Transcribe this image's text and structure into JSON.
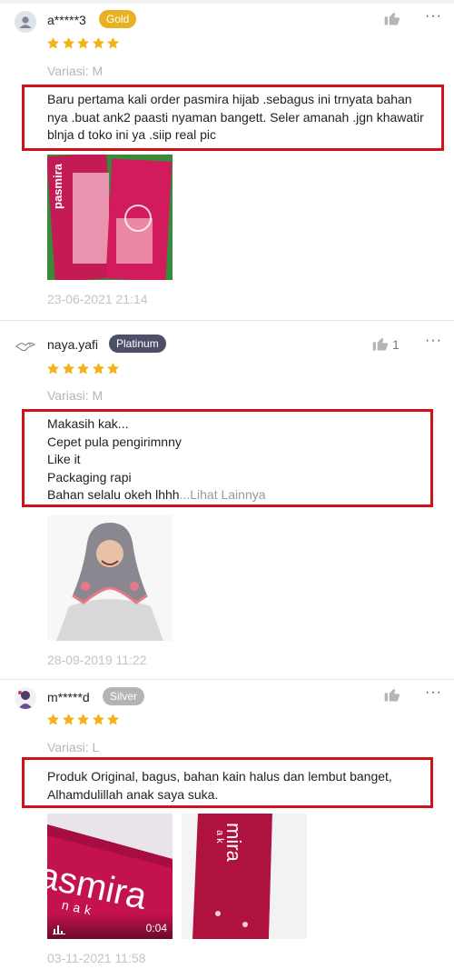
{
  "reviews": [
    {
      "username": "a*****3",
      "badge": "Gold",
      "badge_color": "#e7b122",
      "rating": 5,
      "variation": "Variasi: M",
      "comment_lines": [
        "Baru pertama kali order pasmira hijab .sebagus ini trnyata bahan",
        "nya .buat ank2 paasti nyaman bangett. Seler amanah .jgn khawatir",
        "blnja d toko ini ya .siip real pic"
      ],
      "like_count": "",
      "date": "23-06-2021 21:14",
      "photo_brand": "pasmira"
    },
    {
      "username": "naya.yafi",
      "badge": "Platinum",
      "badge_color": "#4d4f68",
      "rating": 5,
      "variation": "Variasi: M",
      "comment_lines": [
        "Makasih kak...",
        "Cepet pula pengirimnny",
        "Like it",
        "Packaging rapi",
        "Bahan selalu okeh lhhh"
      ],
      "see_more": "...Lihat Lainnya",
      "like_count": "1",
      "date": "28-09-2019 11:22"
    },
    {
      "username": "m*****d",
      "badge": "Silver",
      "badge_color": "#b4b4b4",
      "rating": 5,
      "variation": "Variasi: L",
      "comment_lines": [
        "Produk Original, bagus, bahan kain halus dan lembut banget,",
        "Alhamdulillah anak saya suka."
      ],
      "like_count": "",
      "video_duration": "0:04",
      "photo1_brand": "asmira",
      "photo1_sub": "nak",
      "photo2_brand": "mira",
      "photo2_sub": "ak",
      "date": "03-11-2021 11:58"
    }
  ],
  "colors": {
    "star": "#f6b21b",
    "highlight_border": "#d2121b",
    "muted_text": "#b5b5b5"
  },
  "icons": [
    "user-avatar-icon",
    "thumbs-up-icon",
    "more-options-icon",
    "star-icon",
    "video-stats-icon"
  ]
}
